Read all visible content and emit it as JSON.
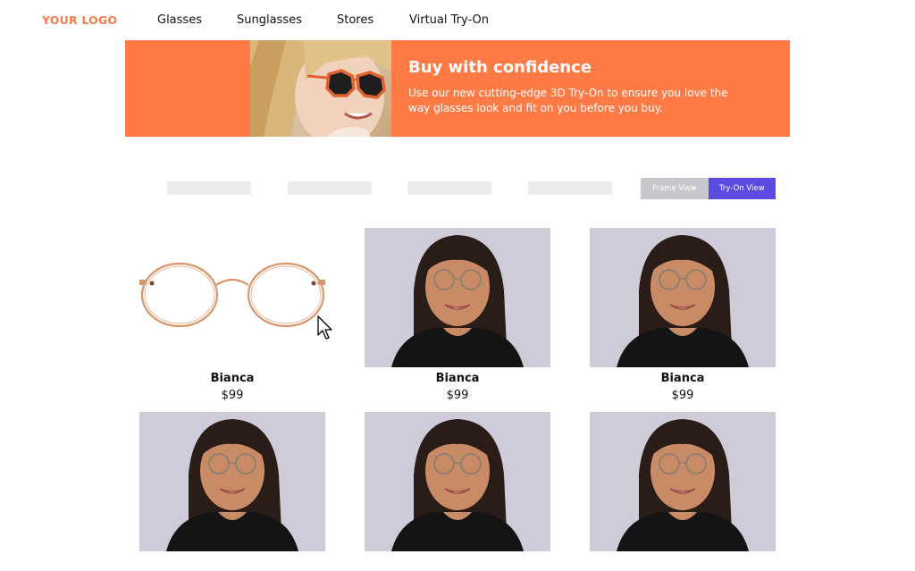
{
  "header": {
    "logo": "YOUR LOGO",
    "nav": [
      {
        "label": "Glasses"
      },
      {
        "label": "Sunglasses"
      },
      {
        "label": "Stores"
      },
      {
        "label": "Virtual Try-On"
      }
    ]
  },
  "banner": {
    "title": "Buy with confidence",
    "text": "Use our new cutting-edge 3D Try-On to ensure you love the way glasses look and fit on you before you buy."
  },
  "view_toggle": {
    "frame_view": "Frame View",
    "try_on_view": "Try-On View",
    "selected": "Try-On View"
  },
  "products": [
    {
      "name": "Bianca",
      "price": "$99",
      "image": "frame-photo"
    },
    {
      "name": "Bianca",
      "price": "$99",
      "image": "model-photo"
    },
    {
      "name": "Bianca",
      "price": "$99",
      "image": "model-photo"
    },
    {
      "name": "",
      "price": "",
      "image": "model-photo"
    },
    {
      "name": "",
      "price": "",
      "image": "model-photo"
    },
    {
      "name": "",
      "price": "",
      "image": "model-photo"
    }
  ],
  "colors": {
    "brand_orange": "#ff7a45",
    "logo_orange": "#f47c4a",
    "accent_purple": "#5b4be0",
    "toggle_gray": "#c7c7cc"
  }
}
